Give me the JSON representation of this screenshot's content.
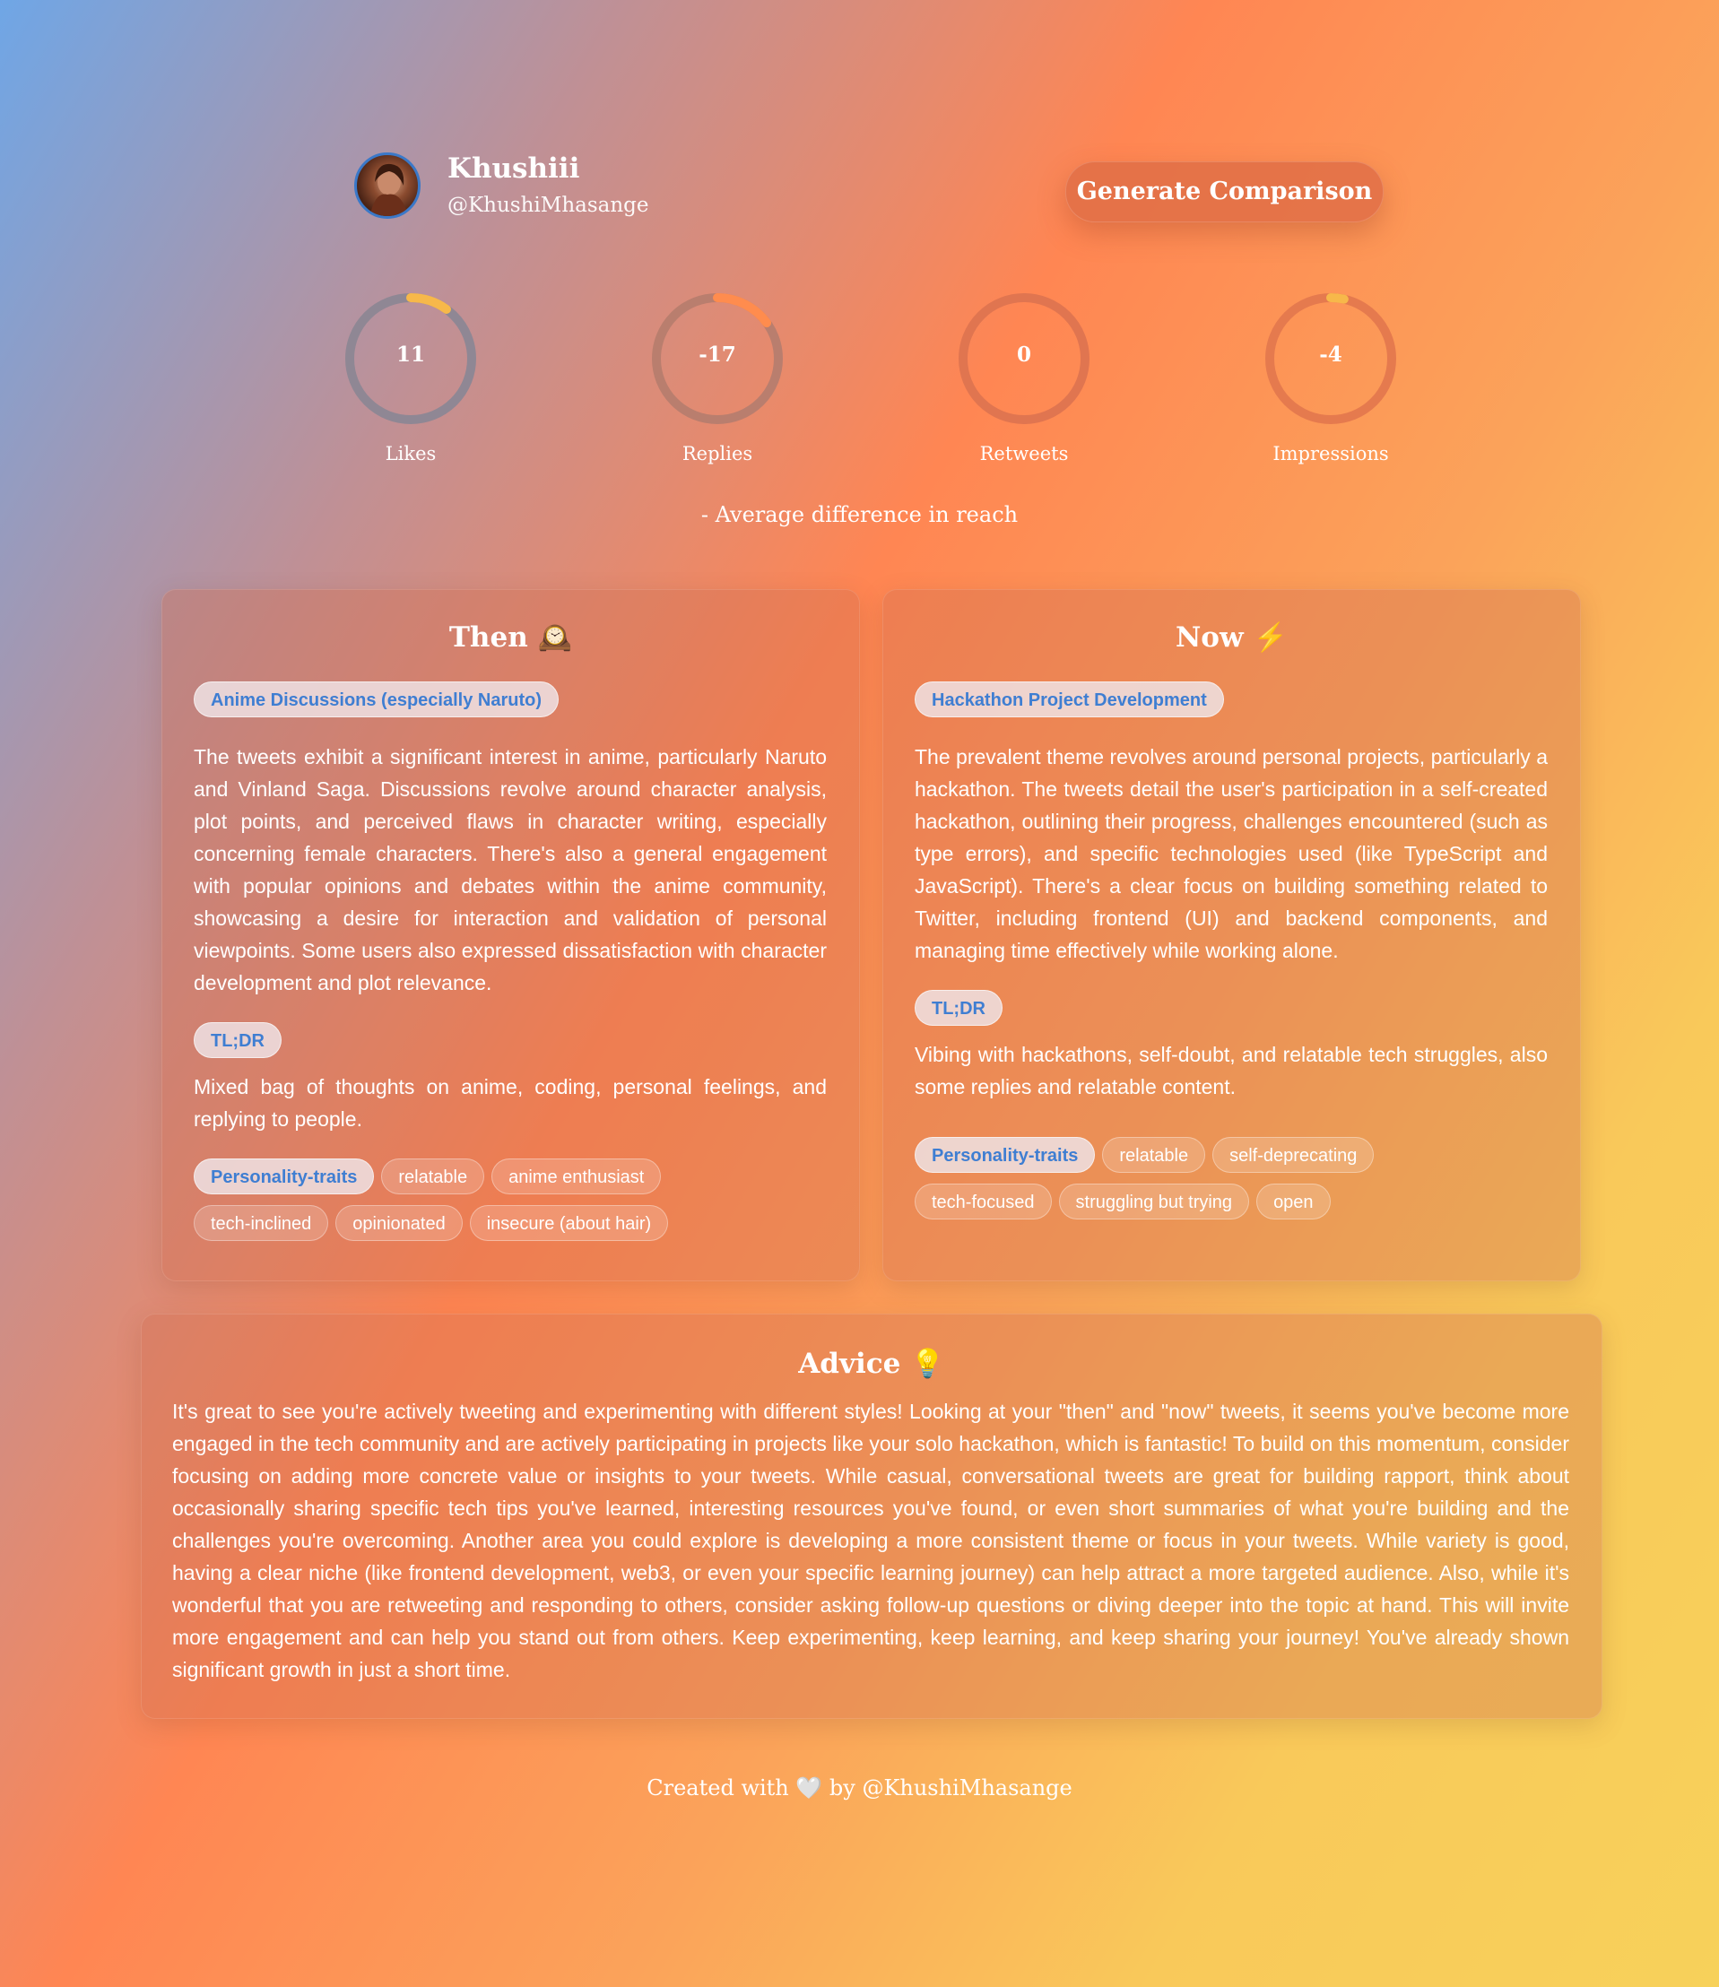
{
  "profile": {
    "name": "Khushiii",
    "handle": "@KhushiMhasange",
    "button": "Generate Comparison"
  },
  "stats": [
    {
      "value": "11",
      "label": "Likes",
      "arc_fraction": 0.1,
      "arc_color": "#f7b84a",
      "ring_color": "#8f8794"
    },
    {
      "value": "-17",
      "label": "Replies",
      "arc_fraction": 0.15,
      "arc_color": "#ff8c4e",
      "ring_color": "#b97e6e"
    },
    {
      "value": "0",
      "label": "Retweets",
      "arc_fraction": 0.0,
      "arc_color": "#ff8c4e",
      "ring_color": "#e07550"
    },
    {
      "value": "-4",
      "label": "Impressions",
      "arc_fraction": 0.035,
      "arc_color": "#f7b84a",
      "ring_color": "#e57a4e"
    }
  ],
  "average_note": "- Average difference in reach",
  "then": {
    "title": "Then 🕰️",
    "topic": "Anime Discussions (especially Naruto)",
    "summary": "The tweets exhibit a significant interest in anime, particularly Naruto and Vinland Saga. Discussions revolve around character analysis, plot points, and perceived flaws in character writing, especially concerning female characters. There's also a general engagement with popular opinions and debates within the anime community, showcasing a desire for interaction and validation of personal viewpoints. Some users also expressed dissatisfaction with character development and plot relevance.",
    "tldr_label": "TL;DR",
    "tldr": "Mixed bag of thoughts on anime, coding, personal feelings, and replying to people.",
    "traits_label": "Personality-traits",
    "traits": [
      "relatable",
      "anime enthusiast",
      "tech-inclined",
      "opinionated",
      "insecure (about hair)"
    ]
  },
  "now": {
    "title": "Now ⚡",
    "topic": "Hackathon Project Development",
    "summary": "The prevalent theme revolves around personal projects, particularly a hackathon. The tweets detail the user's participation in a self-created hackathon, outlining their progress, challenges encountered (such as type errors), and specific technologies used (like TypeScript and JavaScript). There's a clear focus on building something related to Twitter, including frontend (UI) and backend components, and managing time effectively while working alone.",
    "tldr_label": "TL;DR",
    "tldr": "Vibing with hackathons, self-doubt, and relatable tech struggles, also some replies and relatable content.",
    "traits_label": "Personality-traits",
    "traits": [
      "relatable",
      "self-deprecating",
      "tech-focused",
      "struggling but trying",
      "open"
    ]
  },
  "advice": {
    "title": "Advice 💡",
    "text": "It's great to see you're actively tweeting and experimenting with different styles! Looking at your \"then\" and \"now\" tweets, it seems you've become more engaged in the tech community and are actively participating in projects like your solo hackathon, which is fantastic! To build on this momentum, consider focusing on adding more concrete value or insights to your tweets. While casual, conversational tweets are great for building rapport, think about occasionally sharing specific tech tips you've learned, interesting resources you've found, or even short summaries of what you're building and the challenges you're overcoming. Another area you could explore is developing a more consistent theme or focus in your tweets. While variety is good, having a clear niche (like frontend development, web3, or even your specific learning journey) can help attract a more targeted audience. Also, while it's wonderful that you are retweeting and responding to others, consider asking follow-up questions or diving deeper into the topic at hand. This will invite more engagement and can help you stand out from others. Keep experimenting, keep learning, and keep sharing your journey! You've already shown significant growth in just a short time."
  },
  "footer": "Created with 🤍 by @KhushiMhasange"
}
